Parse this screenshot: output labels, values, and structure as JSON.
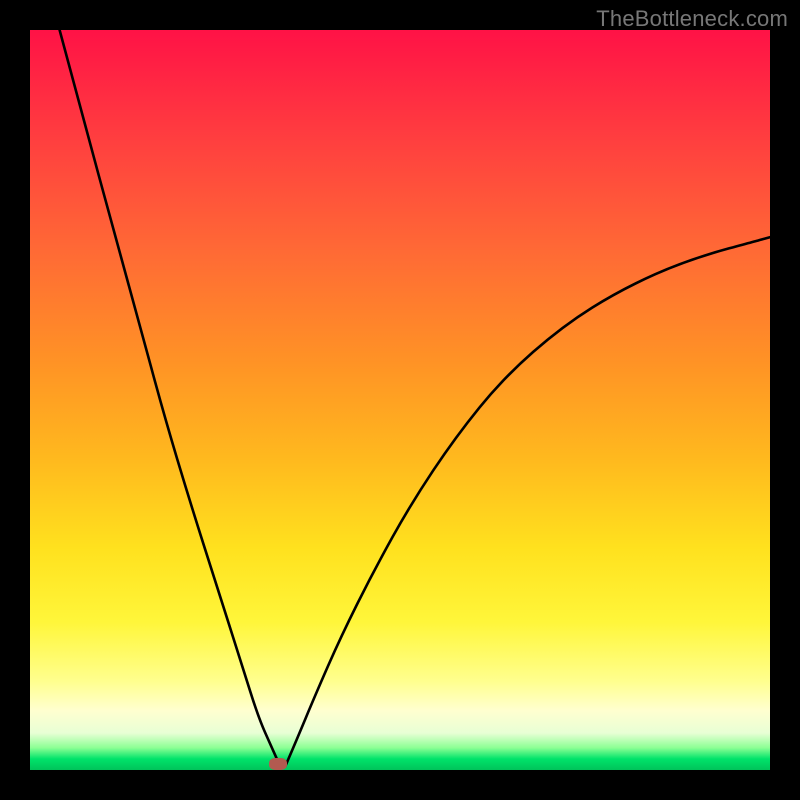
{
  "watermark": "TheBottleneck.com",
  "marker": {
    "x_pct": 33.5,
    "y_pct": 99.2,
    "color": "#b25a50"
  },
  "chart_data": {
    "type": "line",
    "title": "",
    "xlabel": "",
    "ylabel": "",
    "xlim": [
      0,
      100
    ],
    "ylim": [
      0,
      100
    ],
    "series": [
      {
        "name": "left-branch",
        "x": [
          4.0,
          7.5,
          11.0,
          14.6,
          18.1,
          21.7,
          25.2,
          28.7,
          30.9,
          32.7,
          33.8
        ],
        "values": [
          100,
          87,
          74,
          61,
          48,
          36,
          25,
          14,
          7,
          3,
          0.5
        ]
      },
      {
        "name": "right-branch",
        "x": [
          34.5,
          36.0,
          38.5,
          42.0,
          46.5,
          51.5,
          57.5,
          64.0,
          72.0,
          80.0,
          89.0,
          100.0
        ],
        "values": [
          0.5,
          4,
          10,
          18,
          27,
          36,
          45,
          53,
          60,
          65,
          69,
          72
        ]
      }
    ],
    "annotations": [
      {
        "text": "TheBottleneck.com",
        "position": "top-right"
      }
    ]
  }
}
